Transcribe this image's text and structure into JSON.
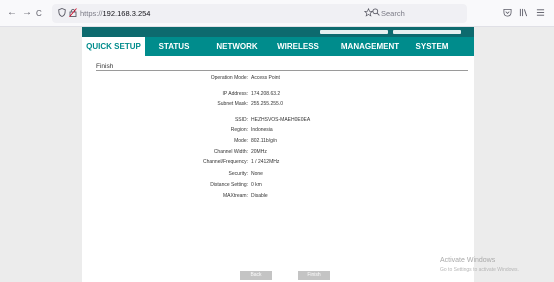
{
  "browser": {
    "back": "←",
    "forward": "→",
    "reload": "C",
    "url_scheme": "https://",
    "url_host": "192.168.3.254",
    "search_placeholder": "Search"
  },
  "nav": {
    "tabs": [
      {
        "label": "QUICK SETUP",
        "active": true
      },
      {
        "label": "STATUS"
      },
      {
        "label": "NETWORK"
      },
      {
        "label": "WIRELESS"
      },
      {
        "label": "MANAGEMENT"
      },
      {
        "label": "SYSTEM"
      }
    ]
  },
  "section": {
    "title": "Finish"
  },
  "rows": [
    {
      "label": "Operation Mode:",
      "value": "Access Point"
    },
    {
      "label": "IP Address:",
      "value": "174.208.63.2"
    },
    {
      "label": "Subnet Mask:",
      "value": "255.255.255.0"
    },
    {
      "label": "SSID:",
      "value": "HEZHSVOS-MAEH0E0EA"
    },
    {
      "label": "Region:",
      "value": "Indonesia"
    },
    {
      "label": "Mode:",
      "value": "802.11b/g/n"
    },
    {
      "label": "Channel Width:",
      "value": "20MHz"
    },
    {
      "label": "Channel/Frequency:",
      "value": "1 / 2412MHz"
    },
    {
      "label": "Security:",
      "value": "None"
    },
    {
      "label": "Distance Setting:",
      "value": "0 km"
    },
    {
      "label": "MAXtream:",
      "value": "Disable"
    }
  ],
  "buttons": {
    "back": "Back",
    "finish": "Finish"
  },
  "watermark": {
    "line1": "Activate Windows",
    "line2": "Go to Settings to activate Windows."
  },
  "colors": {
    "nav_bg": "#008c8c",
    "header_bg": "#0d6a6e"
  }
}
